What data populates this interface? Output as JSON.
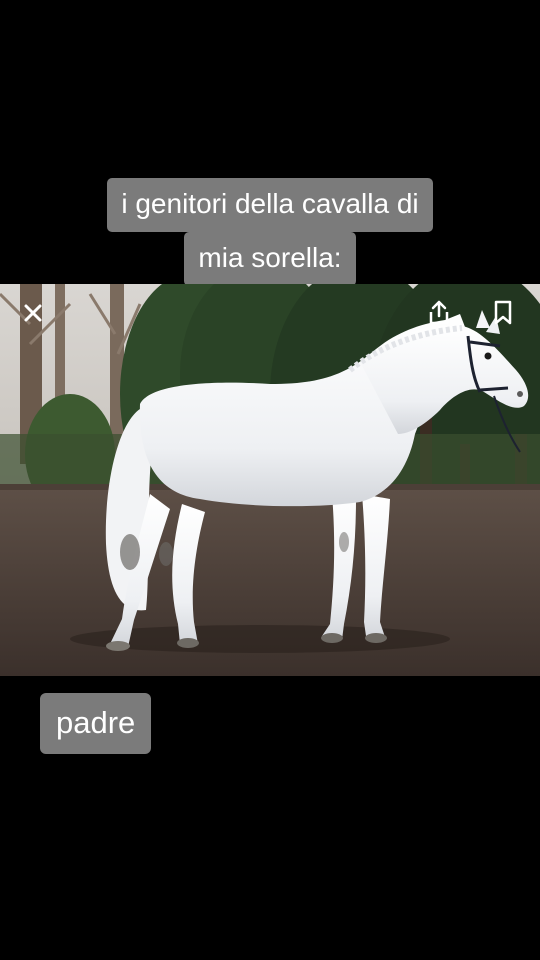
{
  "caption": {
    "line1": "i genitori della cavalla di",
    "line2": "mia sorella:"
  },
  "photo": {
    "subject": "white-horse-photo",
    "overlay_icons": [
      "close-icon",
      "share-icon",
      "bookmark-icon"
    ]
  },
  "bottom_label": "padre",
  "colors": {
    "background": "#000000",
    "caption_bg": "#7b7b7b",
    "caption_text": "#ffffff"
  }
}
